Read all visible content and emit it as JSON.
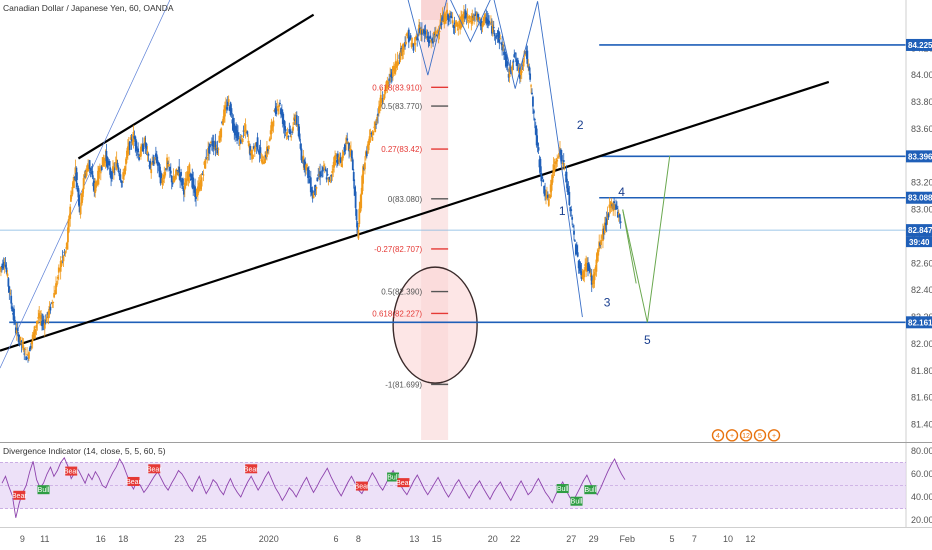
{
  "header": {
    "symbol_line": "Canadian Dollar / Japanese Yen, 60, OANDA",
    "indicator_line": "Divergence Indicator (14, close, 5, 5, 60, 5)"
  },
  "colors": {
    "up": "#f09a1a",
    "down": "#1f5fb8",
    "trendline": "#000000",
    "level": "#1f5fb8",
    "rsi_line": "#8e44ad",
    "rsi_band": "#e6d4f5",
    "bear_tag": "#e53935",
    "bull_tag": "#2e9d43",
    "fib_gray": "#555555",
    "fib_red": "#e53935",
    "highlight": "#f7c7c7"
  },
  "chart_data": [
    {
      "type": "candlestick",
      "title": "Canadian Dollar / Japanese Yen, 60, OANDA",
      "xlabel": "",
      "ylabel": "",
      "ylim": [
        81.3,
        84.5
      ],
      "y_ticks": [
        81.4,
        81.6,
        81.8,
        82.0,
        82.2,
        82.4,
        82.6,
        82.8,
        83.0,
        83.2,
        83.4,
        83.6,
        83.8,
        84.0,
        84.2
      ],
      "x_ticks": [
        "9",
        "11",
        "16",
        "18",
        "23",
        "25",
        "2020",
        "6",
        "8",
        "13",
        "15",
        "20",
        "22",
        "27",
        "29",
        "Feb",
        "5",
        "7",
        "10",
        "12"
      ],
      "x_tick_days": [
        9,
        11,
        16,
        18,
        23,
        25,
        31,
        37,
        39,
        44,
        46,
        51,
        53,
        58,
        60,
        63,
        67,
        69,
        72,
        74
      ],
      "price_path": [
        [
          7,
          82.55
        ],
        [
          7.5,
          82.62
        ],
        [
          8,
          82.35
        ],
        [
          8.5,
          82.1
        ],
        [
          9,
          82.0
        ],
        [
          9.5,
          81.9
        ],
        [
          10,
          82.05
        ],
        [
          10.5,
          82.2
        ],
        [
          11,
          82.15
        ],
        [
          11.5,
          82.25
        ],
        [
          12,
          82.4
        ],
        [
          12.5,
          82.6
        ],
        [
          13,
          82.7
        ],
        [
          13.4,
          83.1
        ],
        [
          13.8,
          83.3
        ],
        [
          14.2,
          83.0
        ],
        [
          14.6,
          83.25
        ],
        [
          15,
          83.35
        ],
        [
          15.5,
          83.15
        ],
        [
          16,
          83.3
        ],
        [
          16.5,
          83.4
        ],
        [
          17,
          83.25
        ],
        [
          17.5,
          83.35
        ],
        [
          18,
          83.2
        ],
        [
          18.5,
          83.45
        ],
        [
          19,
          83.55
        ],
        [
          19.5,
          83.4
        ],
        [
          20,
          83.5
        ],
        [
          20.5,
          83.3
        ],
        [
          21,
          83.4
        ],
        [
          21.5,
          83.2
        ],
        [
          22,
          83.35
        ],
        [
          22.5,
          83.2
        ],
        [
          23,
          83.3
        ],
        [
          23.5,
          83.15
        ],
        [
          24,
          83.3
        ],
        [
          24.5,
          83.1
        ],
        [
          25,
          83.2
        ],
        [
          25.5,
          83.4
        ],
        [
          26,
          83.5
        ],
        [
          26.5,
          83.45
        ],
        [
          27,
          83.7
        ],
        [
          27.5,
          83.8
        ],
        [
          28,
          83.6
        ],
        [
          28.5,
          83.5
        ],
        [
          29,
          83.6
        ],
        [
          29.5,
          83.4
        ],
        [
          30,
          83.5
        ],
        [
          30.5,
          83.35
        ],
        [
          31,
          83.45
        ],
        [
          31.5,
          83.7
        ],
        [
          32,
          83.8
        ],
        [
          32.5,
          83.6
        ],
        [
          33,
          83.55
        ],
        [
          33.5,
          83.7
        ],
        [
          34,
          83.4
        ],
        [
          34.5,
          83.3
        ],
        [
          35,
          83.1
        ],
        [
          35.5,
          83.25
        ],
        [
          36,
          83.3
        ],
        [
          36.5,
          83.2
        ],
        [
          37,
          83.4
        ],
        [
          37.5,
          83.35
        ],
        [
          38,
          83.5
        ],
        [
          38.5,
          83.4
        ],
        [
          39,
          82.8
        ],
        [
          39.5,
          83.3
        ],
        [
          40,
          83.5
        ],
        [
          40.5,
          83.6
        ],
        [
          41,
          83.8
        ],
        [
          41.5,
          83.9
        ],
        [
          42,
          84.0
        ],
        [
          42.5,
          84.1
        ],
        [
          43,
          84.2
        ],
        [
          43.5,
          84.3
        ],
        [
          44,
          84.2
        ],
        [
          44.5,
          84.35
        ],
        [
          45,
          84.3
        ],
        [
          45.5,
          84.25
        ],
        [
          46,
          84.3
        ],
        [
          46.5,
          84.4
        ],
        [
          47,
          84.45
        ],
        [
          47.5,
          84.4
        ],
        [
          48,
          84.35
        ],
        [
          48.5,
          84.45
        ],
        [
          49,
          84.4
        ],
        [
          49.5,
          84.45
        ],
        [
          50,
          84.38
        ],
        [
          50.5,
          84.42
        ],
        [
          51,
          84.35
        ],
        [
          51.5,
          84.3
        ],
        [
          52,
          84.2
        ],
        [
          52.5,
          84.0
        ],
        [
          53,
          84.15
        ],
        [
          53.5,
          84.0
        ],
        [
          54,
          84.2
        ],
        [
          54.5,
          83.9
        ],
        [
          55,
          83.5
        ],
        [
          55.5,
          83.2
        ],
        [
          56,
          83.05
        ],
        [
          56.5,
          83.3
        ],
        [
          57,
          83.45
        ],
        [
          57.5,
          83.3
        ],
        [
          58,
          83.0
        ],
        [
          58.5,
          82.7
        ],
        [
          59,
          82.5
        ],
        [
          59.5,
          82.6
        ],
        [
          60,
          82.45
        ],
        [
          60.5,
          82.7
        ],
        [
          61,
          82.85
        ],
        [
          61.5,
          83.0
        ],
        [
          62,
          83.05
        ],
        [
          62.5,
          82.9
        ]
      ],
      "last_price": 82.847,
      "countdown": "39:40",
      "price_labels": [
        {
          "value": 84.225,
          "text": "84.225"
        },
        {
          "value": 83.396,
          "text": "83.396"
        },
        {
          "value": 83.088,
          "text": "83.088"
        },
        {
          "value": 82.847,
          "text": "82.847"
        },
        {
          "value": 82.161,
          "text": "82.161"
        }
      ],
      "horizontal_levels": [
        84.225,
        83.396,
        83.088,
        82.161
      ],
      "trendlines": [
        {
          "from": [
            7,
            81.95
          ],
          "to": [
            81,
            83.95
          ]
        },
        {
          "from": [
            14,
            83.38
          ],
          "to": [
            35,
            84.45
          ]
        }
      ],
      "zigzag": [
        [
          43,
          84.7
        ],
        [
          45.2,
          84.0
        ],
        [
          47,
          84.6
        ],
        [
          49,
          84.25
        ],
        [
          51,
          84.6
        ],
        [
          53,
          83.9
        ],
        [
          55,
          84.55
        ],
        [
          57,
          83.4
        ],
        [
          59,
          82.2
        ]
      ],
      "fib_levels": [
        {
          "text": "0.618(83.910)",
          "value": 83.91,
          "tone": "red"
        },
        {
          "text": "0.5(83.770)",
          "value": 83.77,
          "tone": "gray"
        },
        {
          "text": "0.27(83.42)",
          "value": 83.45,
          "tone": "red"
        },
        {
          "text": "0(83.080)",
          "value": 83.08,
          "tone": "gray"
        },
        {
          "text": "-0.27(82.707)",
          "value": 82.707,
          "tone": "red"
        },
        {
          "text": "0.5(82.390)",
          "value": 82.39,
          "tone": "gray"
        },
        {
          "text": "0.618(82.227)",
          "value": 82.227,
          "tone": "red"
        },
        {
          "text": "-1(81.699)",
          "value": 81.699,
          "tone": "gray"
        }
      ],
      "wave_labels": [
        {
          "text": "1",
          "day": 57.2,
          "value": 82.96
        },
        {
          "text": "2",
          "day": 58.8,
          "value": 83.6
        },
        {
          "text": "3",
          "day": 61.2,
          "value": 82.28
        },
        {
          "text": "4",
          "day": 62.5,
          "value": 83.1
        },
        {
          "text": "5",
          "day": 64.8,
          "value": 82.0
        }
      ],
      "projection": [
        [
          62.6,
          83.0
        ],
        [
          64.8,
          82.16
        ],
        [
          66.8,
          83.4
        ]
      ]
    },
    {
      "type": "line",
      "title": "Divergence Indicator (14, close, 5, 5, 60, 5)",
      "xlabel": "",
      "ylabel": "",
      "ylim": [
        14,
        86
      ],
      "y_ticks": [
        20.0,
        40.0,
        60.0,
        80.0
      ],
      "bands": [
        30,
        70
      ],
      "series": [
        {
          "values": [
            52,
            58,
            49,
            41,
            22,
            35,
            44,
            50,
            62,
            71,
            55,
            48,
            52,
            60,
            66,
            58,
            63,
            70,
            74,
            67,
            56,
            61,
            64,
            58,
            52,
            60,
            55,
            62,
            57,
            50,
            48,
            55,
            61,
            66,
            73,
            68,
            60,
            52,
            47,
            54,
            50,
            44,
            48,
            53,
            58,
            62,
            56,
            50,
            46,
            52,
            57,
            63,
            60,
            55,
            49,
            45,
            52,
            58,
            50,
            43,
            48,
            55,
            52,
            46,
            42,
            50,
            56,
            49,
            44,
            40,
            47,
            53,
            58,
            52,
            46,
            51,
            57,
            62,
            55,
            48,
            43,
            37,
            42,
            48,
            45,
            40,
            46,
            52,
            57,
            50,
            44,
            49,
            55,
            60,
            65,
            58,
            52,
            46,
            41,
            47,
            53,
            58,
            52,
            46,
            43,
            49,
            55,
            61,
            56,
            50,
            46,
            52,
            58,
            63,
            57,
            51,
            46,
            42,
            48,
            54,
            59,
            53,
            47,
            42,
            47,
            52,
            57,
            51,
            45,
            40,
            45,
            51,
            55,
            49,
            44,
            39,
            45,
            50,
            54,
            48,
            43,
            38,
            44,
            49,
            53,
            47,
            42,
            37,
            43,
            49,
            54,
            48,
            42,
            45,
            51,
            56,
            50,
            44,
            40,
            35,
            42,
            48,
            53,
            46,
            40,
            36,
            42,
            48,
            54,
            59,
            52,
            46,
            42,
            48,
            55,
            62,
            68,
            73,
            66,
            60,
            55
          ]
        }
      ],
      "tags": [
        {
          "text": "Bear",
          "kind": "bear",
          "index": 5
        },
        {
          "text": "Bull",
          "kind": "bull",
          "index": 12
        },
        {
          "text": "Bear",
          "kind": "bear",
          "index": 20
        },
        {
          "text": "Bear",
          "kind": "bear",
          "index": 38
        },
        {
          "text": "Bear",
          "kind": "bear",
          "index": 44
        },
        {
          "text": "Bear",
          "kind": "bear",
          "index": 72
        },
        {
          "text": "Bear",
          "kind": "bear",
          "index": 104
        },
        {
          "text": "Bull",
          "kind": "bull",
          "index": 113
        },
        {
          "text": "Bear",
          "kind": "bear",
          "index": 116
        },
        {
          "text": "Bull",
          "kind": "bull",
          "index": 162
        },
        {
          "text": "Bull",
          "kind": "bull",
          "index": 166
        },
        {
          "text": "Bull",
          "kind": "bull",
          "index": 170
        }
      ]
    }
  ],
  "event_badges": [
    "4",
    "+",
    "12",
    "5",
    "+"
  ]
}
